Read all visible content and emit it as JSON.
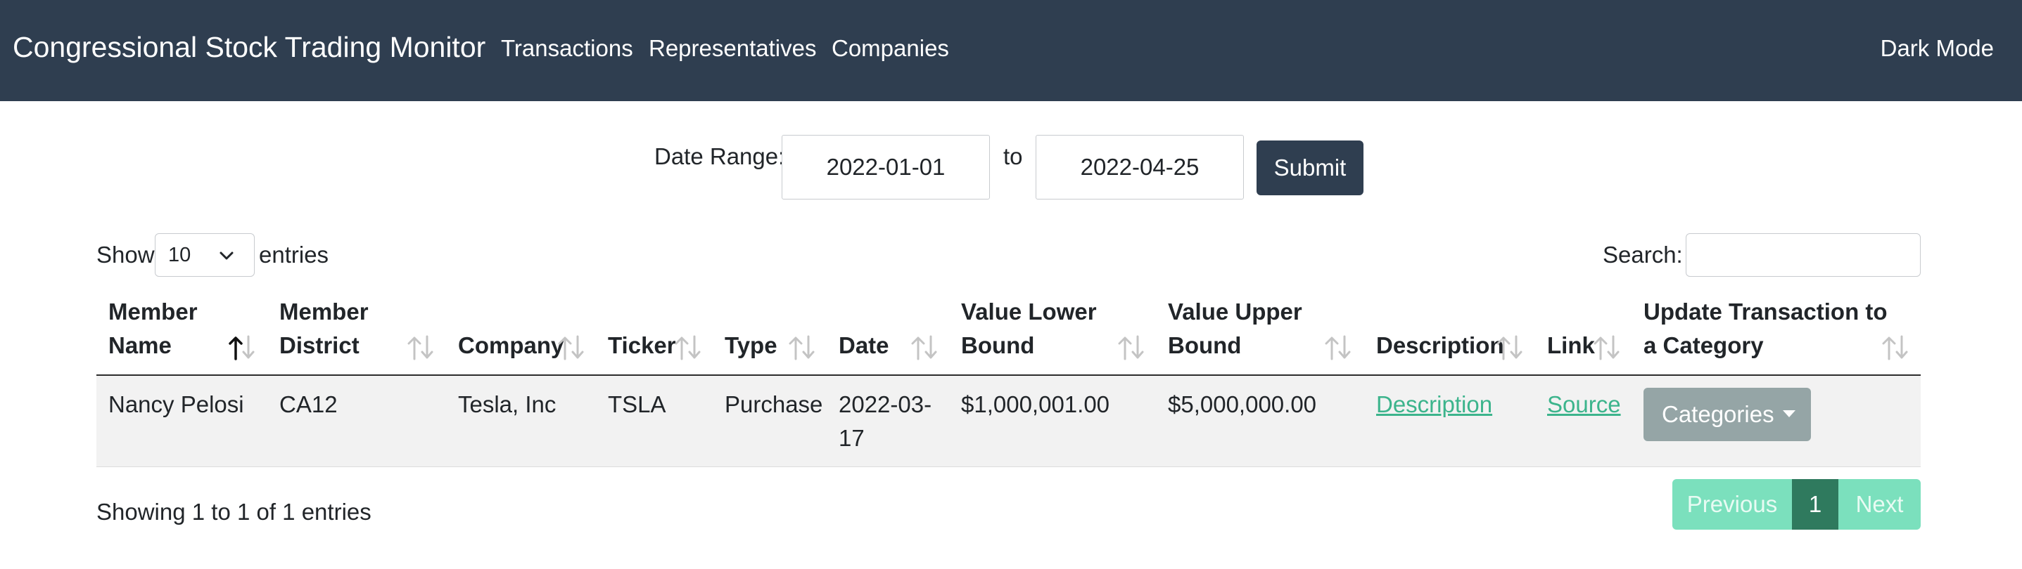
{
  "navbar": {
    "brand": "Congressional Stock Trading Monitor",
    "links": [
      "Transactions",
      "Representatives",
      "Companies"
    ],
    "dark_mode": "Dark Mode"
  },
  "filter": {
    "date_range_label": "Date Range:",
    "start_date": "2022-01-01",
    "to_label": "to",
    "end_date": "2022-04-25",
    "submit_label": "Submit"
  },
  "table_controls": {
    "show_label": "Show",
    "entries_value": "10",
    "entries_label": "entries",
    "search_label": "Search:",
    "search_value": ""
  },
  "table": {
    "headers": [
      {
        "line1": "Member",
        "line2": "Name",
        "sort": "ascending"
      },
      {
        "line1": "Member",
        "line2": "District",
        "sort": "none"
      },
      {
        "line1": "",
        "line2": "Company",
        "sort": "none"
      },
      {
        "line1": "",
        "line2": "Ticker",
        "sort": "none"
      },
      {
        "line1": "",
        "line2": "Type",
        "sort": "none"
      },
      {
        "line1": "",
        "line2": "Date",
        "sort": "none"
      },
      {
        "line1": "Value Lower",
        "line2": "Bound",
        "sort": "none"
      },
      {
        "line1": "Value Upper",
        "line2": "Bound",
        "sort": "none"
      },
      {
        "line1": "",
        "line2": "Description",
        "sort": "none"
      },
      {
        "line1": "",
        "line2": "Link",
        "sort": "none"
      },
      {
        "line1": "Update Transaction to",
        "line2": "a Category",
        "sort": "none"
      }
    ],
    "rows": [
      {
        "member_name": "Nancy Pelosi",
        "member_district": "CA12",
        "company": "Tesla, Inc",
        "ticker": "TSLA",
        "type": "Purchase",
        "date_line1": "2022-03-",
        "date_line2": "17",
        "value_lower": "$1,000,001.00",
        "value_upper": "$5,000,000.00",
        "description": "Description",
        "link": "Source",
        "category_button": "Categories"
      }
    ]
  },
  "footer": {
    "info": "Showing 1 to 1 of 1 entries",
    "previous": "Previous",
    "page": "1",
    "next": "Next"
  },
  "colors": {
    "navbar": "#2f3e50",
    "link": "#3cb48c",
    "pagination_active": "#2f7a5e",
    "pagination_inactive": "#7be0bd",
    "category_button": "#95a5a6"
  }
}
